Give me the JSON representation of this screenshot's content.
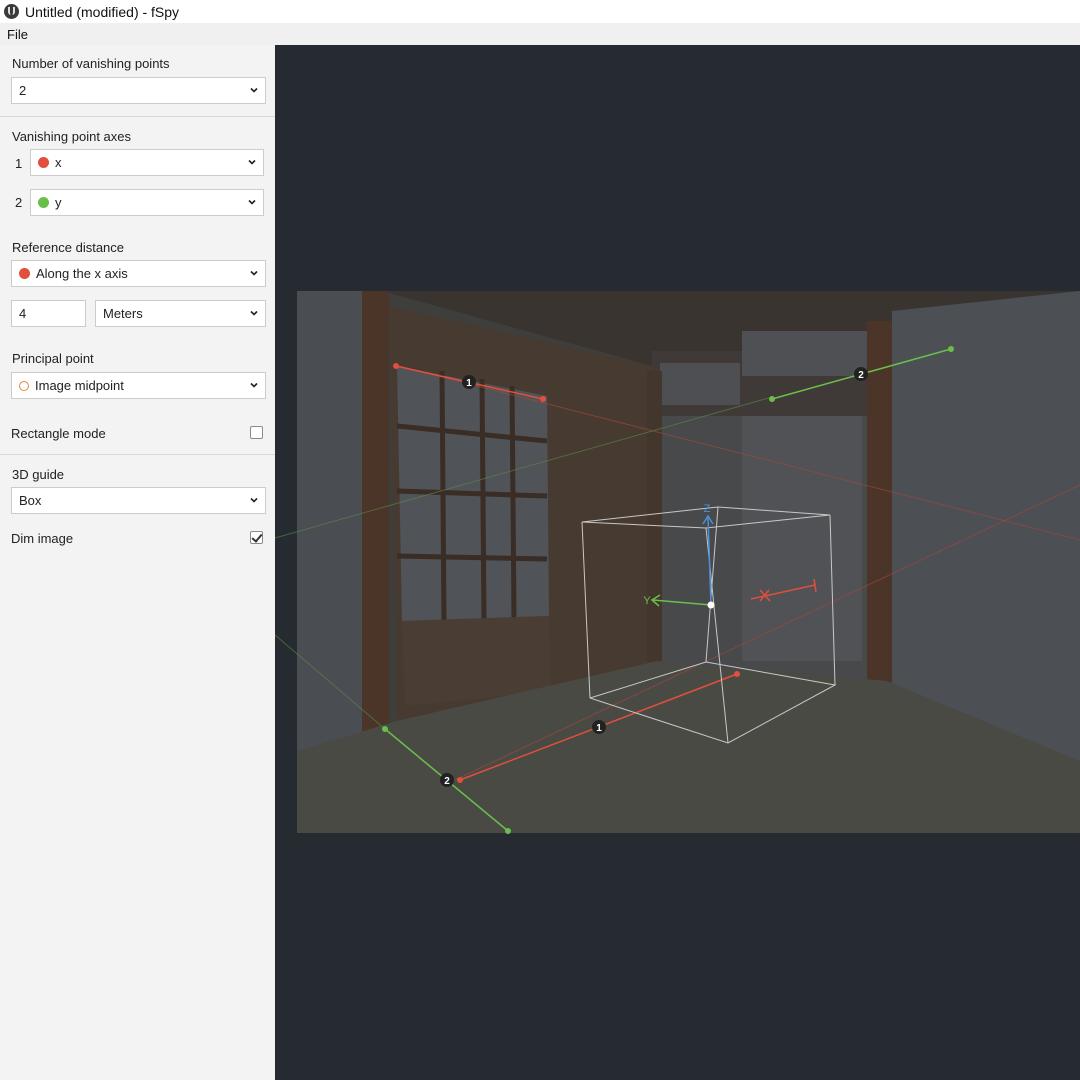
{
  "window": {
    "title": "Untitled (modified) - fSpy"
  },
  "menu": {
    "file": "File"
  },
  "sidebar": {
    "vp_count": {
      "label": "Number of vanishing points",
      "value": "2"
    },
    "vp_axes": {
      "label": "Vanishing point axes",
      "axis1": {
        "index": "1",
        "value": "x",
        "color": "#e0503c"
      },
      "axis2": {
        "index": "2",
        "value": "y",
        "color": "#6abf4b"
      }
    },
    "reference": {
      "label": "Reference distance",
      "axis": "Along the x axis",
      "distance": "4",
      "unit": "Meters"
    },
    "principal": {
      "label": "Principal point",
      "value": "Image midpoint"
    },
    "rect_mode": {
      "label": "Rectangle mode",
      "checked": false
    },
    "guide": {
      "label": "3D guide",
      "value": "Box"
    },
    "dim": {
      "label": "Dim image",
      "checked": true
    }
  },
  "viewport": {
    "control_points": {
      "vp1_line_a": "1",
      "vp1_line_b": "1",
      "vp2_line_a": "2",
      "vp2_line_b": "2"
    },
    "axes": {
      "z": "Z",
      "y": "Y"
    }
  },
  "colors": {
    "x_axis": "#e0503c",
    "y_axis": "#6abf4b",
    "z_axis": "#4a90d9",
    "viewport_bg": "#262b31"
  }
}
